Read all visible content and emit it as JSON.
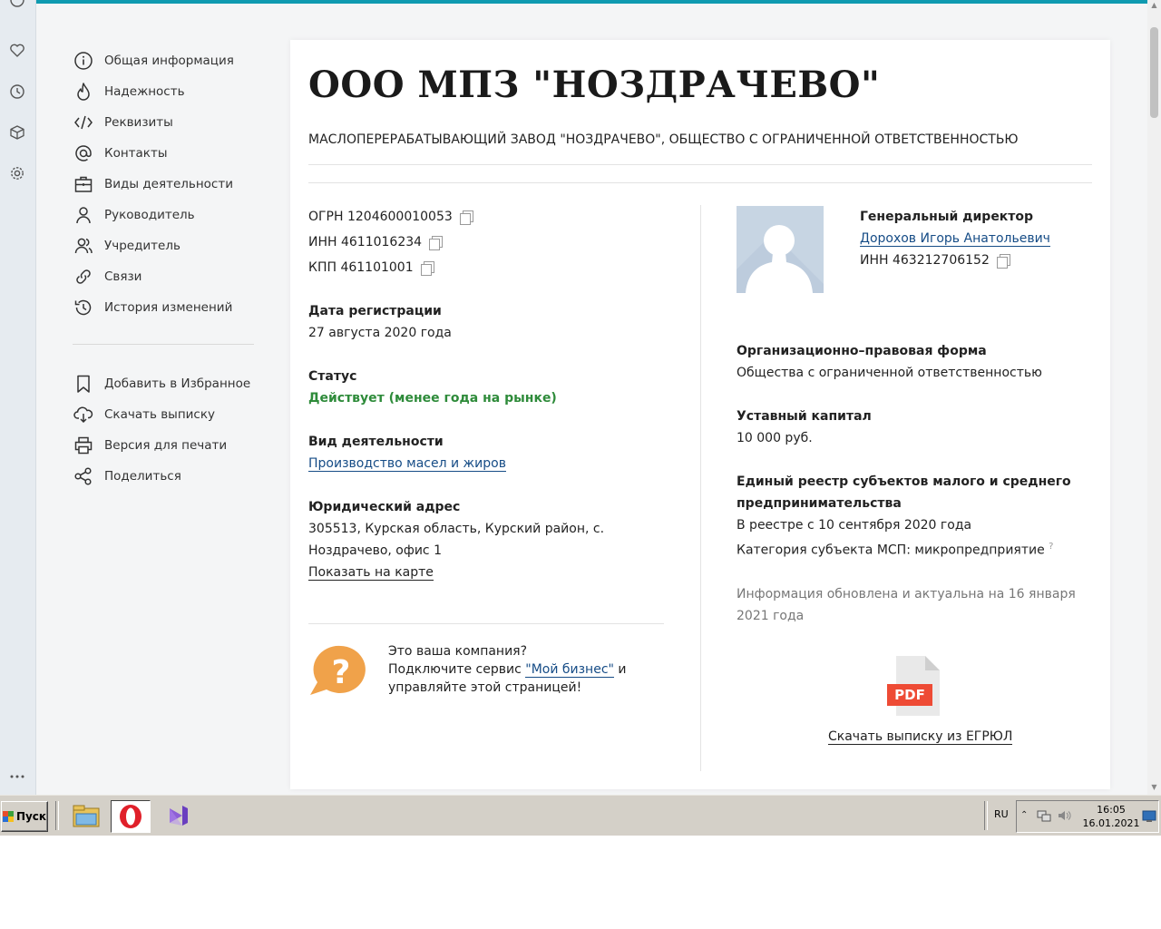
{
  "company": {
    "title": "ООО МПЗ \"НОЗДРАЧЕВО\"",
    "full_name": "МАСЛОПЕРЕРАБАТЫВАЮЩИЙ ЗАВОД \"НОЗДРАЧЕВО\", ОБЩЕСТВО С ОГРАНИЧЕННОЙ ОТВЕТСТВЕННОСТЬЮ",
    "ogrn": "ОГРН 1204600010053",
    "inn": "ИНН 4611016234",
    "kpp": "КПП 461101001",
    "reg_date_label": "Дата регистрации",
    "reg_date": "27 августа 2020 года",
    "status_label": "Статус",
    "status": "Действует (менее года на рынке)",
    "activity_label": "Вид деятельности",
    "activity": "Производство масел и жиров",
    "address_label": "Юридический адрес",
    "address_line1": "305513, Курская область, Курский район, с.",
    "address_line2": "Ноздрачево, офис 1",
    "map_link": "Показать на карте"
  },
  "promo": {
    "line1": "Это ваша компания?",
    "line2_pre": "Подключите сервис ",
    "line2_link": "\"Мой бизнес\"",
    "line2_post": " и",
    "line3": "управляйте этой страницей!"
  },
  "director": {
    "role": "Генеральный директор",
    "name": "Дорохов Игорь Анатольевич",
    "inn": "ИНН 463212706152"
  },
  "details": {
    "legal_form_label": "Организационно–правовая форма",
    "legal_form": "Общества с ограниченной ответственностью",
    "capital_label": "Уставный капитал",
    "capital": "10 000 руб.",
    "sme_label_1": "Единый реестр субъектов малого и среднего",
    "sme_label_2": "предпринимательства",
    "sme_since": "В реестре с 10 сентября 2020 года",
    "sme_category": "Категория субъекта МСП: микропредприятие",
    "sme_help": "?",
    "updated_1": "Информация обновлена и актуальна на 16 января",
    "updated_2": "2021 года",
    "pdf_badge": "PDF",
    "pdf_link": "Скачать выписку из ЕГРЮЛ"
  },
  "nav": {
    "items": [
      {
        "label": "Общая информация",
        "icon": "info-icon"
      },
      {
        "label": "Надежность",
        "icon": "flame-icon"
      },
      {
        "label": "Реквизиты",
        "icon": "code-icon"
      },
      {
        "label": "Контакты",
        "icon": "at-icon"
      },
      {
        "label": "Виды деятельности",
        "icon": "briefcase-icon"
      },
      {
        "label": "Руководитель",
        "icon": "person-icon"
      },
      {
        "label": "Учредитель",
        "icon": "people-icon"
      },
      {
        "label": "Связи",
        "icon": "link-icon"
      },
      {
        "label": "История изменений",
        "icon": "history-icon"
      }
    ],
    "actions": [
      {
        "label": "Добавить в Избранное",
        "icon": "bookmark-icon"
      },
      {
        "label": "Скачать выписку",
        "icon": "download-icon"
      },
      {
        "label": "Версия для печати",
        "icon": "printer-icon"
      },
      {
        "label": "Поделиться",
        "icon": "share-icon"
      }
    ]
  },
  "taskbar": {
    "start_label": "Пуск",
    "lang": "RU",
    "time": "16:05",
    "date": "16.01.2021"
  },
  "colors": {
    "accent_topline": "#0f9ab0",
    "link": "#164c86",
    "status_green": "#2e8b3a",
    "promo_orange": "#f0a24a"
  }
}
